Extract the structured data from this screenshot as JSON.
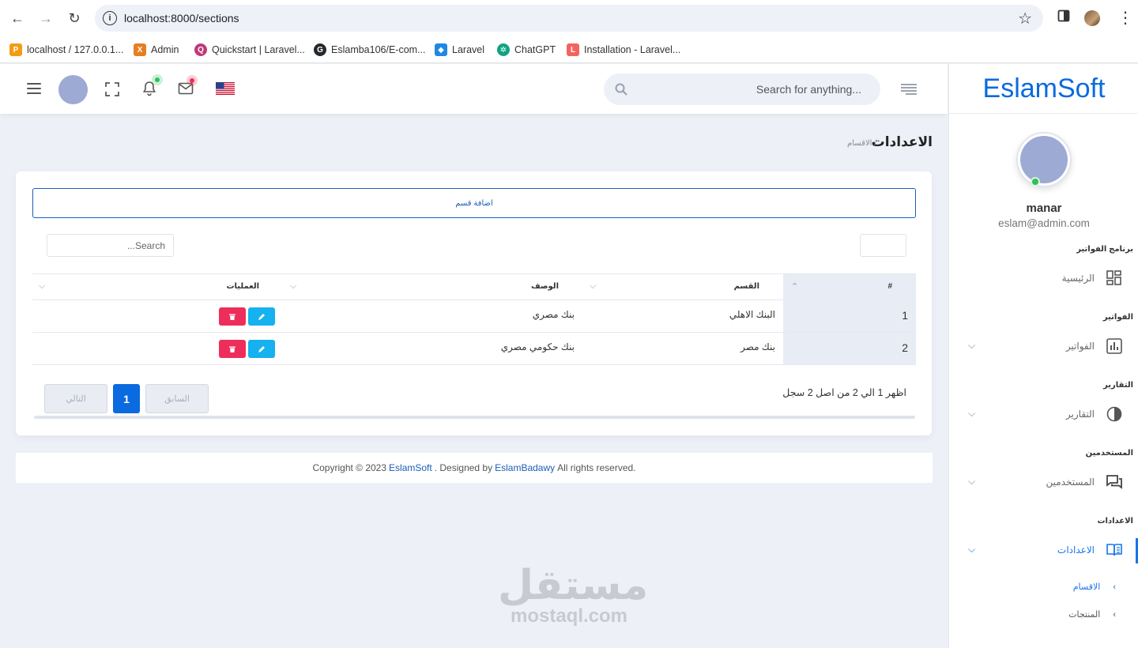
{
  "browser": {
    "url": "localhost:8000/sections",
    "bookmarks": [
      {
        "label": "localhost / 127.0.0.1...",
        "color": "#f39c12",
        "glyph": "P"
      },
      {
        "label": "Admin",
        "color": "#e67e22",
        "glyph": "X"
      },
      {
        "label": "Quickstart | Laravel...",
        "color": "#c0397a",
        "glyph": "Q"
      },
      {
        "label": "Eslamba106/E-com...",
        "color": "#24292e",
        "glyph": "G"
      },
      {
        "label": "Laravel",
        "color": "#1e88e5",
        "glyph": "◆"
      },
      {
        "label": "ChatGPT",
        "color": "#10a37f",
        "glyph": "✲"
      },
      {
        "label": "Installation - Laravel...",
        "color": "#f4645f",
        "glyph": "L"
      }
    ]
  },
  "header": {
    "search_placeholder": "Search for anything...",
    "icons": [
      "menu-icon",
      "fullscreen-icon",
      "bell-icon",
      "mail-icon",
      "us-flag-icon",
      "align-right-icon"
    ]
  },
  "sidebar": {
    "brand": "EslamSoft",
    "user_name": "manar",
    "user_email": "eslam@admin.com",
    "sections": [
      {
        "category": "برنامج الفواتير",
        "item": "الرئيسية",
        "has_chevron": false
      },
      {
        "category": "الفواتير",
        "item": "الفواتير",
        "has_chevron": true
      },
      {
        "category": "التقارير",
        "item": "التقارير",
        "has_chevron": true
      },
      {
        "category": "المستخدمين",
        "item": "المستخدمين",
        "has_chevron": true
      },
      {
        "category": "الاعدادات",
        "item": "الاعدادات",
        "has_chevron": true
      }
    ],
    "sub_items": [
      "الاقسام",
      "المنتجات"
    ]
  },
  "page": {
    "title": "الاعدادات",
    "breadcrumb": "/ الاقسام",
    "add_button": "اضافة قسم",
    "table_search_placeholder": "Search...",
    "columns": [
      "#",
      "القسم",
      "الوصف",
      "العمليات"
    ],
    "rows": [
      {
        "num": "1",
        "section": "البنك الاهلي",
        "description": "بنك مصري"
      },
      {
        "num": "2",
        "section": "بنك مصر",
        "description": "بنك حكومي مصري"
      }
    ],
    "info": "اظهر 1 الي 2 من اصل 2 سجل",
    "pagination": {
      "prev": "السابق",
      "current": "1",
      "next": "التالي"
    }
  },
  "footer": {
    "prefix": "Copyright © 2023",
    "brand": "EslamSoft",
    "middle": ". Designed by",
    "author": "EslamBadawy",
    "suffix": "All rights reserved."
  },
  "watermark": {
    "arabic": "مستقل",
    "latin": "mostaql.com"
  },
  "colors": {
    "primary": "#0a6adf",
    "delete": "#ee2e5a",
    "edit": "#16b1ef",
    "background": "#eef0f8"
  }
}
